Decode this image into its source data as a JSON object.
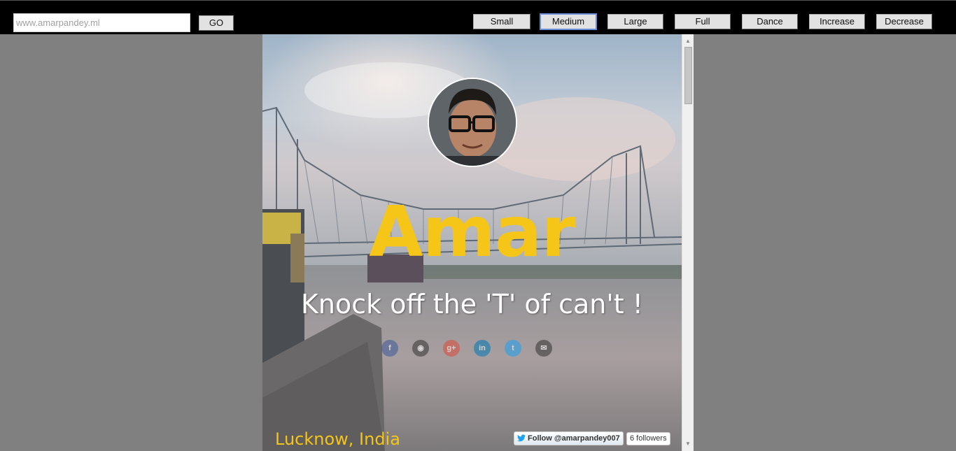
{
  "toolbar": {
    "url_placeholder": "www.amarpandey.ml",
    "go_label": "GO",
    "buttons": [
      {
        "label": "Small",
        "active": false
      },
      {
        "label": "Medium",
        "active": true
      },
      {
        "label": "Large",
        "active": false
      },
      {
        "label": "Full",
        "active": false
      },
      {
        "label": "Dance",
        "active": false
      },
      {
        "label": "Increase",
        "active": false
      },
      {
        "label": "Decrease",
        "active": false
      }
    ]
  },
  "profile": {
    "name": "Amar",
    "tagline": "Knock off the 'T' of can't !",
    "location": "Lucknow, India",
    "social_icons": [
      {
        "icon": "facebook-icon",
        "glyph": "f",
        "color": "#3b5998"
      },
      {
        "icon": "github-icon",
        "glyph": "◉",
        "color": "#333333"
      },
      {
        "icon": "google-plus-icon",
        "glyph": "g+",
        "color": "#dd4b39"
      },
      {
        "icon": "linkedin-icon",
        "glyph": "in",
        "color": "#0077b5"
      },
      {
        "icon": "twitter-icon",
        "glyph": "t",
        "color": "#1da1f2"
      },
      {
        "icon": "email-icon",
        "glyph": "✉",
        "color": "#333333"
      }
    ]
  },
  "twitter": {
    "follow_label": "Follow @amarpandey007",
    "followers_label": "6 followers"
  },
  "colors": {
    "accent": "#f5c518",
    "toolbar": "#000000",
    "page_bg": "#808080"
  }
}
